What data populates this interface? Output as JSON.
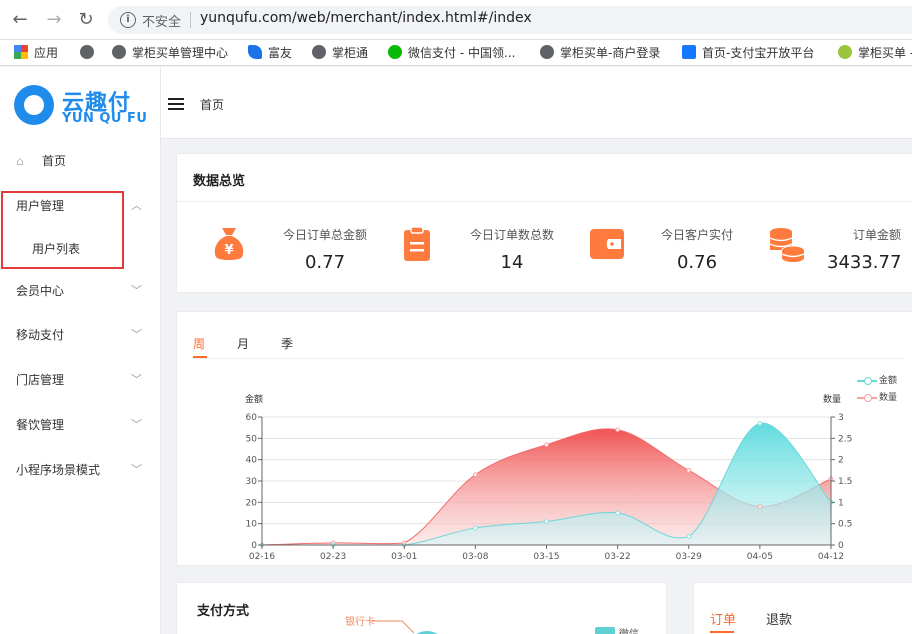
{
  "browser": {
    "insecure_label": "不安全",
    "url": "yunqufu.com/web/merchant/index.html#/index",
    "bookmarks": [
      {
        "label": "应用",
        "icon": "apps-grid-icon",
        "color": "#e94235"
      },
      {
        "label": "掌柜买单管理中心",
        "icon": "globe-icon",
        "color": "#5f6368"
      },
      {
        "label": "富友",
        "icon": "fuiou-icon",
        "color": "#1a73e8"
      },
      {
        "label": "掌柜通",
        "icon": "globe-icon",
        "color": "#5f6368"
      },
      {
        "label": "微信支付 - 中国领...",
        "icon": "wechat-icon",
        "color": "#09bb07"
      },
      {
        "label": "掌柜买单-商户登录",
        "icon": "globe-icon",
        "color": "#5f6368"
      },
      {
        "label": "首页-支付宝开放平台",
        "icon": "alipay-icon",
        "color": "#1677ff"
      },
      {
        "label": "掌柜买单 -",
        "icon": "ie-icon",
        "color": "#9bc53d"
      }
    ]
  },
  "logo": {
    "cn": "云趣付",
    "en": "YUN QU FU"
  },
  "sidebar": {
    "home": "首页",
    "items": [
      {
        "label": "用户管理",
        "chevron": "up"
      },
      {
        "label": "用户列表",
        "sub": true
      },
      {
        "label": "会员中心",
        "chevron": "down"
      },
      {
        "label": "移动支付",
        "chevron": "down"
      },
      {
        "label": "门店管理",
        "chevron": "down"
      },
      {
        "label": "餐饮管理",
        "chevron": "down"
      },
      {
        "label": "小程序场景模式",
        "chevron": "down"
      }
    ]
  },
  "header": {
    "breadcrumb": "首页"
  },
  "overview": {
    "title": "数据总览",
    "stats": [
      {
        "label": "今日订单总金额",
        "value": "0.77",
        "icon": "money-bag-icon"
      },
      {
        "label": "今日订单数总数",
        "value": "14",
        "icon": "clipboard-icon"
      },
      {
        "label": "今日客户实付",
        "value": "0.76",
        "icon": "wallet-icon"
      },
      {
        "label": "订单金额",
        "value": "3433.77",
        "icon": "coins-stack-icon"
      }
    ],
    "accent": "#ff7a3d"
  },
  "chart_tabs": [
    "周",
    "月",
    "季"
  ],
  "chart_data": {
    "type": "area",
    "x": [
      "02-16",
      "02-23",
      "03-01",
      "03-08",
      "03-15",
      "03-22",
      "03-29",
      "04-05",
      "04-12"
    ],
    "series": [
      {
        "name": "金额",
        "axis": "left",
        "color": "#6dd6d9",
        "values": [
          0,
          0,
          0,
          8,
          11,
          15,
          4,
          57,
          20
        ]
      },
      {
        "name": "数量",
        "axis": "right",
        "color": "#f26b6b",
        "values": [
          0,
          0.05,
          0.05,
          1.65,
          2.35,
          2.7,
          1.75,
          0.9,
          1.55
        ]
      }
    ],
    "ylabel_left": "金额",
    "ylabel_right": "数量",
    "ylim_left": [
      0,
      60
    ],
    "yticks_left": [
      "0",
      "10",
      "20",
      "30",
      "40",
      "50",
      "60"
    ],
    "ylim_right": [
      0,
      3
    ],
    "yticks_right": [
      "0",
      "0.5",
      "1",
      "1.5",
      "2",
      "2.5",
      "3"
    ],
    "legend_position": "top-right",
    "grid": true
  },
  "payment": {
    "title": "支付方式",
    "label_bank": "银行卡",
    "legend_wechat": "微信"
  },
  "orders": {
    "tabs": [
      "订单",
      "退款"
    ]
  }
}
